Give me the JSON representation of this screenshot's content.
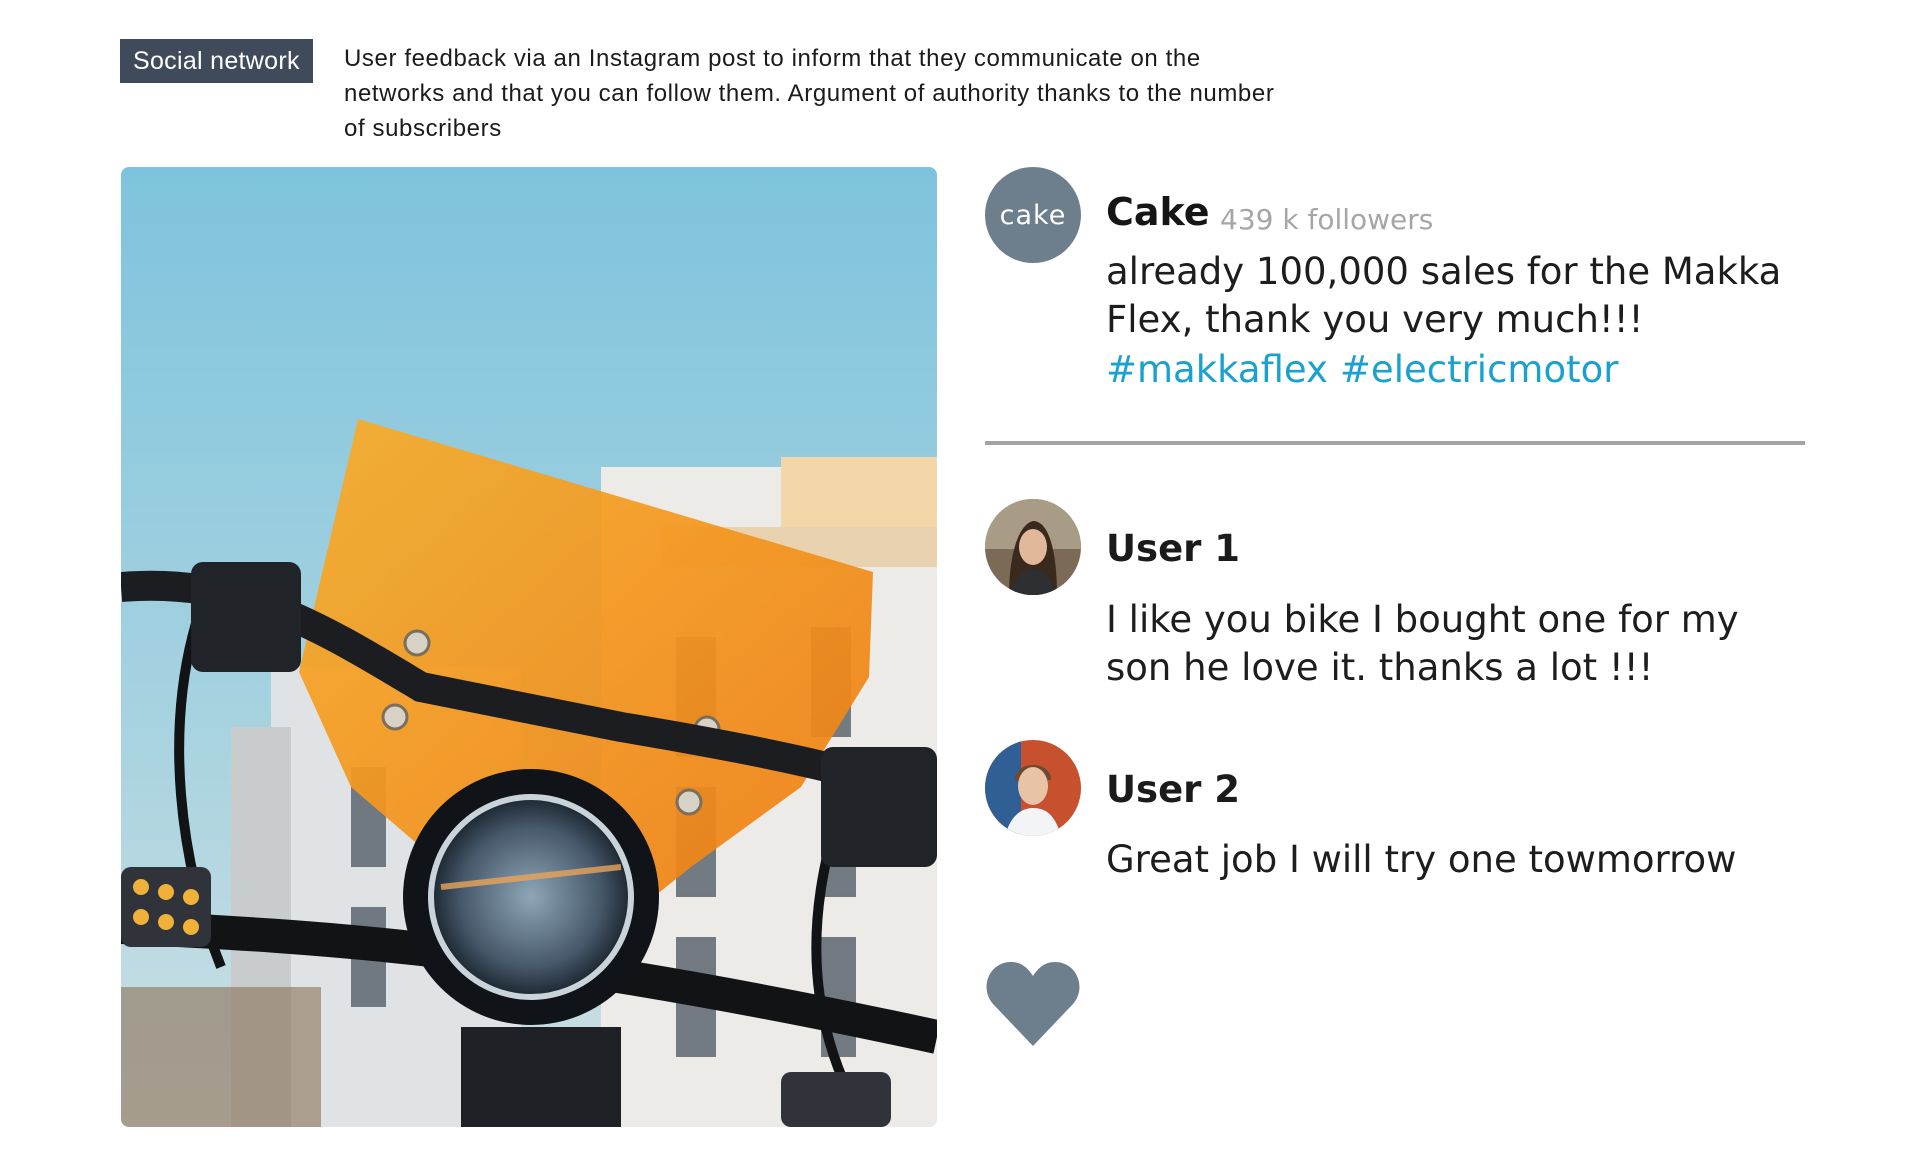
{
  "header": {
    "tag": "Social network",
    "description": "User feedback via an Instagram post to inform that they communicate on the networks and that you can follow them. Argument of authority thanks to the number of subscribers"
  },
  "post": {
    "brand_avatar_text": "cake",
    "brand_name": "Cake",
    "followers": "439 k followers",
    "text": "already 100,000 sales for the Makka Flex, thank you very much!!!",
    "hashtags": [
      "#makkaflex",
      "#electricmotor"
    ],
    "image_icon": "motorbike-photo"
  },
  "comments": [
    {
      "user": "User 1",
      "text": "I like you bike I bought one for my son he love it. thanks a lot !!!"
    },
    {
      "user": "User 2",
      "text": "Great job I will try one towmorrow"
    }
  ],
  "like_icon": "heart-icon",
  "colors": {
    "tag_bg": "#3f4a5b",
    "avatar_bg": "#6d7f8d",
    "hashtag": "#1aa1cf",
    "heart": "#6d7f8d",
    "divider": "#a4a4a4",
    "followers": "#a6a6a6"
  }
}
